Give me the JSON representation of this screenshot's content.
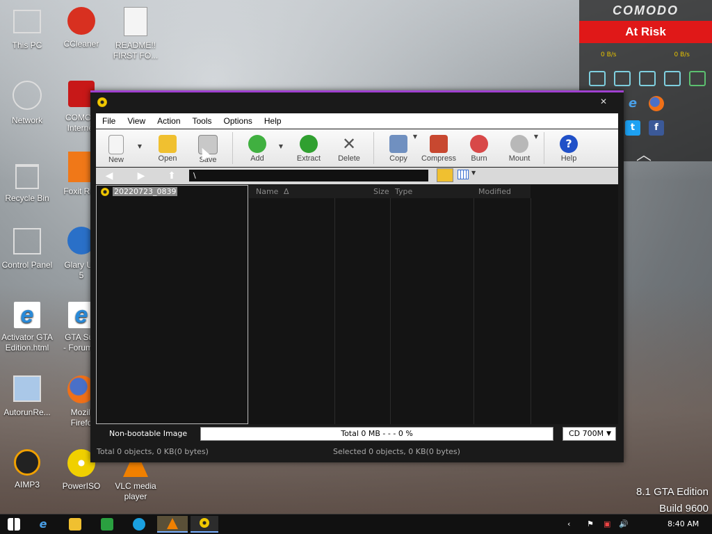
{
  "desktop": {
    "icons": [
      {
        "label": "This PC"
      },
      {
        "label": "CCleaner"
      },
      {
        "label": "README!!\nFIRST FO..."
      },
      {
        "label": "Network"
      },
      {
        "label": "COMOD\nInternet"
      },
      {
        "label": "Recycle Bin"
      },
      {
        "label": "Foxit Rea"
      },
      {
        "label": "Control Panel"
      },
      {
        "label": "Glary Util\n5"
      },
      {
        "label": "Activator GTA\nEdition.html"
      },
      {
        "label": "GTA Sup\n- Forum.h"
      },
      {
        "label": "AutorunRe..."
      },
      {
        "label": "Mozill\nFirefo"
      },
      {
        "label": "AIMP3"
      },
      {
        "label": "PowerISO"
      },
      {
        "label": "VLC media\nplayer"
      }
    ],
    "watermark": {
      "line1": "8.1 GTA Edition",
      "line2": "Build 9600"
    }
  },
  "comodo": {
    "brand": "COMODO",
    "status": "At Risk",
    "speed_left": "0 B/s",
    "speed_right": "0 B/s",
    "social_twitter": "t",
    "social_facebook": "f"
  },
  "window": {
    "menu": [
      "File",
      "View",
      "Action",
      "Tools",
      "Options",
      "Help"
    ],
    "toolbar": {
      "new": "New",
      "open": "Open",
      "save": "Save",
      "add": "Add",
      "extract": "Extract",
      "delete": "Delete",
      "copy": "Copy",
      "compress": "Compress",
      "burn": "Burn",
      "mount": "Mount",
      "help": "Help"
    },
    "address": "\\",
    "tree_item": "20220723_0839",
    "columns": {
      "name": "Name",
      "sort": "Δ",
      "size": "Size",
      "type": "Type",
      "modified": "Modified"
    },
    "status": {
      "image_type": "Non-bootable Image",
      "total": "Total  0 MB   - - -  0 %",
      "media": "CD 700M",
      "total_objects": "Total 0 objects, 0 KB(0 bytes)",
      "selected_objects": "Selected 0 objects, 0 KB(0 bytes)"
    }
  },
  "taskbar": {
    "clock": "8:40 AM"
  }
}
